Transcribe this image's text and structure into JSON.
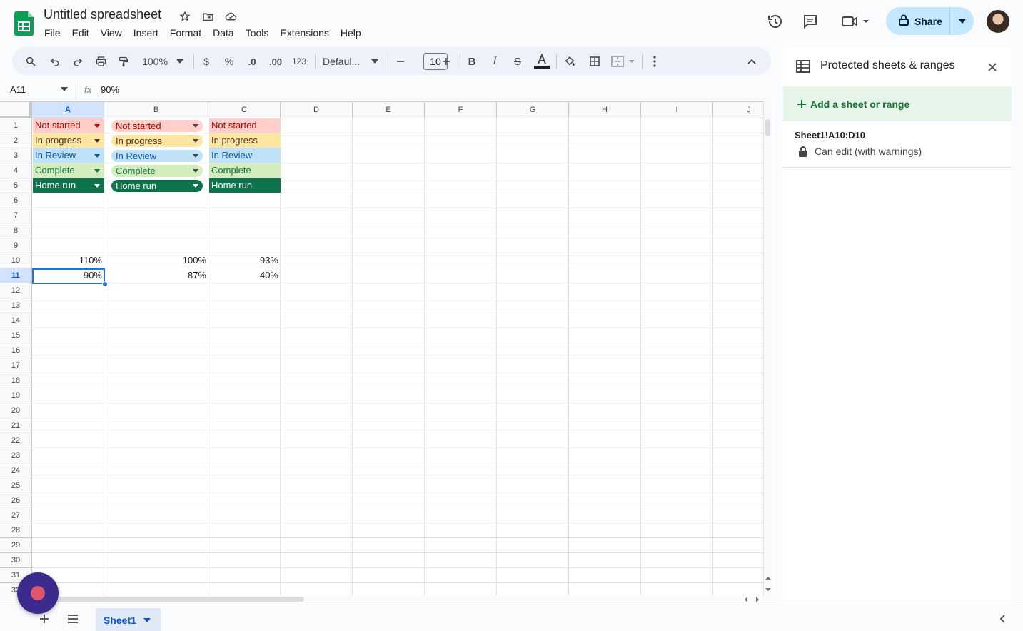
{
  "app": {
    "title": "Untitled spreadsheet"
  },
  "menu": [
    "File",
    "Edit",
    "View",
    "Insert",
    "Format",
    "Data",
    "Tools",
    "Extensions",
    "Help"
  ],
  "share": {
    "label": "Share"
  },
  "toolbar": {
    "zoom": "100%",
    "currency": "$",
    "percent": "%",
    "dec_less": ".0",
    "dec_more": ".00",
    "number_format": "123",
    "font": "Defaul...",
    "font_size": "10"
  },
  "formula": {
    "cell_ref": "A11",
    "fx": "fx",
    "value": "90%"
  },
  "columns": [
    "A",
    "B",
    "C",
    "D",
    "E",
    "F",
    "G",
    "H",
    "I",
    "J"
  ],
  "rows": [
    "1",
    "2",
    "3",
    "4",
    "5",
    "6",
    "7",
    "8",
    "9",
    "10",
    "11",
    "12",
    "13",
    "14",
    "15",
    "16",
    "17",
    "18",
    "19",
    "20",
    "21",
    "22",
    "23",
    "24",
    "25",
    "26",
    "27",
    "28",
    "29",
    "30",
    "31",
    "32"
  ],
  "cells": {
    "col_a": [
      "Not started",
      "In progress",
      "In Review",
      "Complete",
      "Home run"
    ],
    "col_b": [
      "Not started",
      "In progress",
      "In Review",
      "Complete",
      "Home run"
    ],
    "col_c": [
      "Not started",
      "In progress",
      "In Review",
      "Complete",
      "Home run"
    ],
    "row10": [
      "110%",
      "100%",
      "93%"
    ],
    "row11": [
      "90%",
      "87%",
      "40%"
    ]
  },
  "status_colors": {
    "not_started": {
      "bg": "#ffcfc9",
      "fg": "#b10202"
    },
    "in_progress": {
      "bg": "#ffe5a0",
      "fg": "#473822"
    },
    "in_review": {
      "bg": "#bfe1f6",
      "fg": "#0a53a8"
    },
    "complete": {
      "bg": "#d4edbc",
      "fg": "#11734b"
    },
    "home_run": {
      "bg": "#11734b",
      "fg": "#ffffff"
    }
  },
  "sheet_tab": {
    "label": "Sheet1"
  },
  "panel": {
    "title": "Protected sheets & ranges",
    "add_label": "Add a sheet or range",
    "ranges": [
      {
        "name": "Sheet1!A10:D10",
        "permission": "Can edit (with warnings)"
      }
    ]
  }
}
